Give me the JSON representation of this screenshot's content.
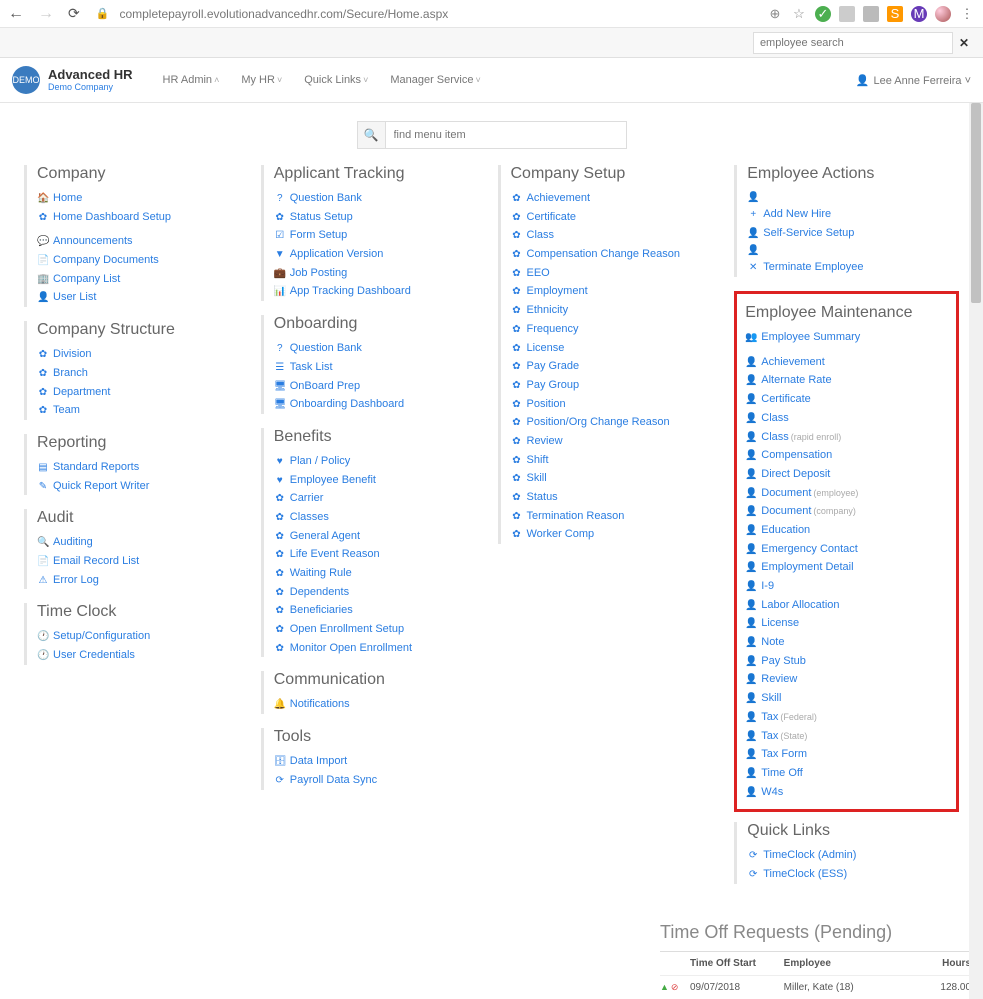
{
  "browser": {
    "url": "completepayroll.evolutionadvancedhr.com/Secure/Home.aspx"
  },
  "search": {
    "placeholder": "employee search"
  },
  "brand": {
    "name": "Advanced HR",
    "company": "Demo Company"
  },
  "nav": {
    "hr_admin": "HR Admin",
    "my_hr": "My HR",
    "quick_links": "Quick Links",
    "manager_service": "Manager Service"
  },
  "user": {
    "name": "Lee Anne Ferreira"
  },
  "finder": {
    "placeholder": "find menu item"
  },
  "col1": {
    "company_title": "Company",
    "company": {
      "home": "Home",
      "dashboard_setup": "Home Dashboard Setup",
      "announcements": "Announcements",
      "company_docs": "Company Documents",
      "company_list": "Company List",
      "user_list": "User List"
    },
    "structure_title": "Company Structure",
    "structure": {
      "division": "Division",
      "branch": "Branch",
      "department": "Department",
      "team": "Team"
    },
    "reporting_title": "Reporting",
    "reporting": {
      "standard": "Standard Reports",
      "quick_writer": "Quick Report Writer"
    },
    "audit_title": "Audit",
    "audit": {
      "auditing": "Auditing",
      "email_log": "Email Record List",
      "error_log": "Error Log"
    },
    "timeclock_title": "Time Clock",
    "timeclock": {
      "setup": "Setup/Configuration",
      "creds": "User Credentials"
    }
  },
  "col2": {
    "applicant_title": "Applicant Tracking",
    "applicant": {
      "qbank": "Question Bank",
      "status_setup": "Status Setup",
      "form_setup": "Form Setup",
      "app_version": "Application Version",
      "job_posting": "Job Posting",
      "dashboard": "App Tracking Dashboard"
    },
    "onboarding_title": "Onboarding",
    "onboarding": {
      "qbank": "Question Bank",
      "task_list": "Task List",
      "onboard_prep": "OnBoard Prep",
      "dashboard": "Onboarding Dashboard"
    },
    "benefits_title": "Benefits",
    "benefits": {
      "plan": "Plan / Policy",
      "emp_benefit": "Employee Benefit",
      "carrier": "Carrier",
      "classes": "Classes",
      "general_agent": "General Agent",
      "life_event": "Life Event Reason",
      "waiting": "Waiting Rule",
      "dependents": "Dependents",
      "beneficiaries": "Beneficiaries",
      "open_enroll_setup": "Open Enrollment Setup",
      "monitor_open": "Monitor Open Enrollment"
    },
    "communication_title": "Communication",
    "communication": {
      "notifications": "Notifications"
    },
    "tools_title": "Tools",
    "tools": {
      "data_import": "Data Import",
      "payroll_sync": "Payroll Data Sync"
    }
  },
  "col3": {
    "setup_title": "Company Setup",
    "setup": {
      "achievement": "Achievement",
      "certificate": "Certificate",
      "class": "Class",
      "comp_change": "Compensation Change Reason",
      "eeo": "EEO",
      "employment": "Employment",
      "ethnicity": "Ethnicity",
      "frequency": "Frequency",
      "license": "License",
      "pay_grade": "Pay Grade",
      "pay_group": "Pay Group",
      "position": "Position",
      "pos_change": "Position/Org Change Reason",
      "review": "Review",
      "shift": "Shift",
      "skill": "Skill",
      "status": "Status",
      "term_reason": "Termination Reason",
      "worker_comp": "Worker Comp"
    }
  },
  "col4": {
    "actions_title": "Employee Actions",
    "actions": {
      "add_new": "Add New Hire",
      "self_service": "Self-Service Setup",
      "terminate": "Terminate Employee"
    },
    "maint_title": "Employee Maintenance",
    "emp_summary": "Employee Summary",
    "maint": {
      "achievement": "Achievement",
      "alternate_rate": "Alternate Rate",
      "certificate": "Certificate",
      "class": "Class",
      "class_rapid": "Class",
      "class_rapid_suffix": "(rapid enroll)",
      "compensation": "Compensation",
      "direct_deposit": "Direct Deposit",
      "doc_emp": "Document",
      "doc_emp_suffix": "(employee)",
      "doc_comp": "Document",
      "doc_comp_suffix": "(company)",
      "education": "Education",
      "emergency": "Emergency Contact",
      "emp_detail": "Employment Detail",
      "i9": "I-9",
      "labor_alloc": "Labor Allocation",
      "license": "License",
      "note": "Note",
      "pay_stub": "Pay Stub",
      "review": "Review",
      "skill": "Skill",
      "tax_fed": "Tax",
      "tax_fed_suffix": "(Federal)",
      "tax_state": "Tax",
      "tax_state_suffix": "(State)",
      "tax_form": "Tax Form",
      "time_off": "Time Off",
      "w4s": "W4s"
    },
    "quicklinks_title": "Quick Links",
    "quicklinks": {
      "tc_admin": "TimeClock (Admin)",
      "tc_ess": "TimeClock (ESS)"
    }
  },
  "pending": {
    "title": "Time Off Requests (Pending)",
    "headers": {
      "start": "Time Off Start",
      "employee": "Employee",
      "hours": "Hours"
    },
    "row": {
      "date": "09/07/2018",
      "employee": "Miller, Kate (18)",
      "hours": "128.00"
    }
  }
}
